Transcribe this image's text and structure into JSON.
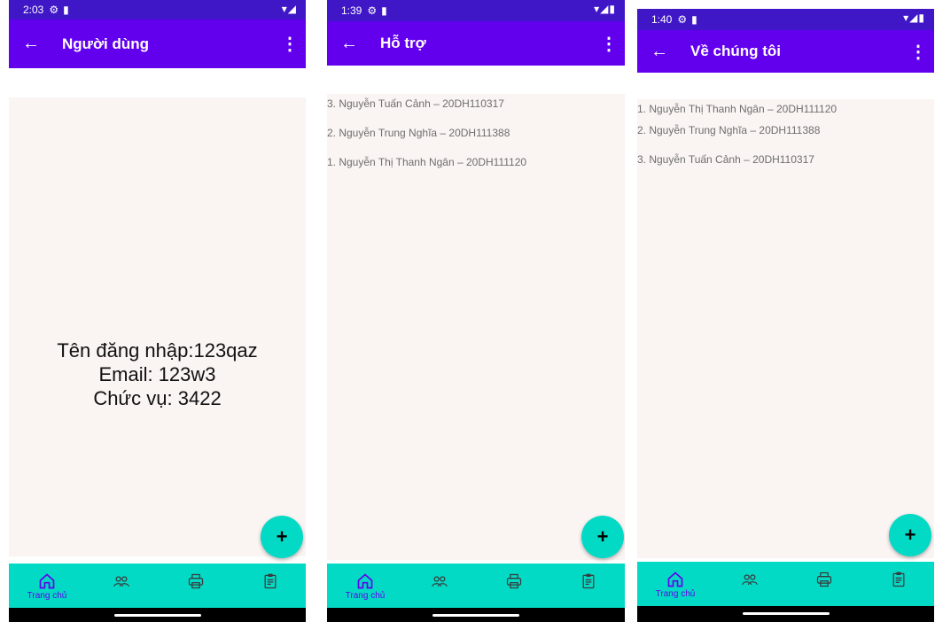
{
  "screens": [
    {
      "status_time": "2:03",
      "title": "Người dùng",
      "info": {
        "username": "Tên đăng nhập:123qaz",
        "email": "Email: 123w3",
        "role": "Chức vụ: 3422"
      },
      "fab_label": "+",
      "nav": [
        "Trang chủ"
      ]
    },
    {
      "status_time": "1:39",
      "title": "Hỗ trợ",
      "lines": [
        "3. Nguyễn Tuấn Cảnh – 20DH110317",
        "2. Nguyễn Trung Nghĩa – 20DH111388",
        "1. Nguyễn Thị Thanh Ngân – 20DH111120"
      ],
      "fab_label": "+",
      "nav": [
        "Trang chủ"
      ]
    },
    {
      "status_time": "1:40",
      "title": "Về chúng tôi",
      "lines": [
        "1. Nguyễn Thị Thanh Ngân – 20DH111120",
        "2. Nguyễn Trung Nghĩa – 20DH111388",
        "3. Nguyễn Tuấn Cảnh – 20DH110317"
      ],
      "fab_label": "+",
      "nav": [
        "Trang chủ"
      ]
    }
  ],
  "icons": [
    "back-arrow-icon",
    "more-vert-icon",
    "home-icon",
    "users-icon",
    "printer-icon",
    "clipboard-icon",
    "settings-icon",
    "sd-card-icon",
    "wifi-icon",
    "signal-icon",
    "battery-icon"
  ],
  "colors": {
    "status_bar": "#3f17c7",
    "app_bar": "#6200ee",
    "accent": "#03dac5",
    "content_bg": "#faf4f3"
  }
}
